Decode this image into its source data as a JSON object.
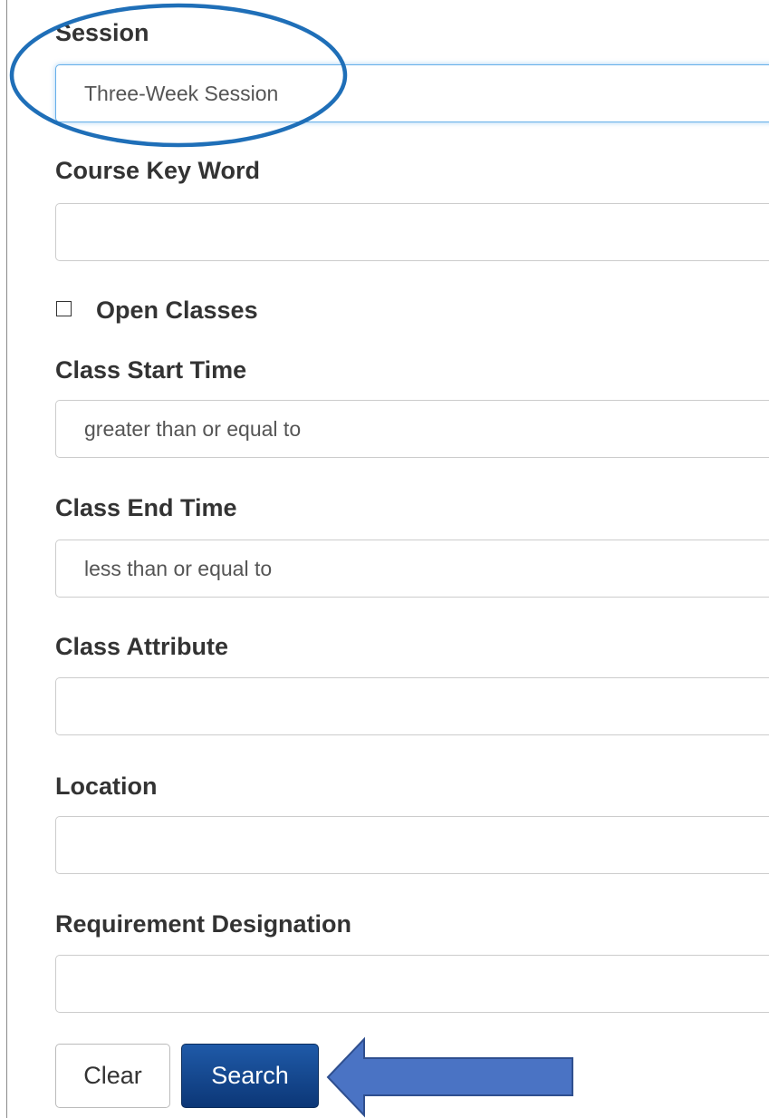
{
  "form": {
    "session": {
      "label": "Session",
      "value": "Three-Week Session"
    },
    "course_key_word": {
      "label": "Course Key Word",
      "value": ""
    },
    "open_classes": {
      "label": "Open Classes",
      "checked": false
    },
    "class_start_time": {
      "label": "Class Start Time",
      "value": "greater than or equal to"
    },
    "class_end_time": {
      "label": "Class End Time",
      "value": "less than or equal to"
    },
    "class_attribute": {
      "label": "Class Attribute",
      "value": ""
    },
    "location": {
      "label": "Location",
      "value": ""
    },
    "requirement_designation": {
      "label": "Requirement Designation",
      "value": ""
    }
  },
  "buttons": {
    "clear_label": "Clear",
    "search_label": "Search"
  },
  "annotations": {
    "ellipse_color": "#1f6fb8",
    "arrow_fill": "#4a73c4",
    "arrow_stroke": "#2f4f8f"
  },
  "colors": {
    "search_button": "#0c3777",
    "focus_border": "#66afe9"
  }
}
